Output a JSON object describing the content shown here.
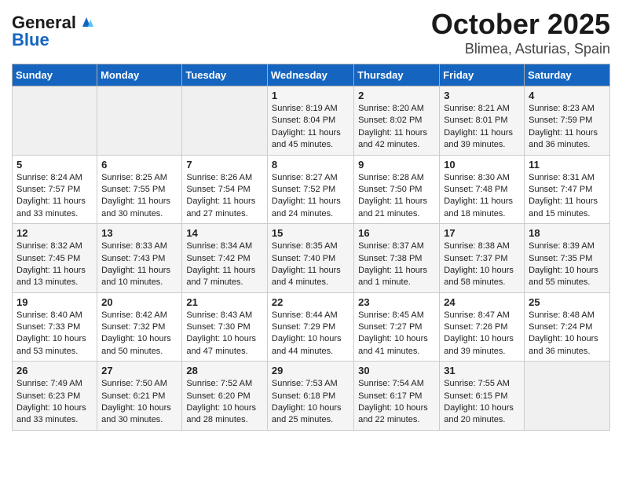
{
  "header": {
    "logo_line1": "General",
    "logo_line2": "Blue",
    "title": "October 2025",
    "subtitle": "Blimea, Asturias, Spain"
  },
  "weekdays": [
    "Sunday",
    "Monday",
    "Tuesday",
    "Wednesday",
    "Thursday",
    "Friday",
    "Saturday"
  ],
  "weeks": [
    [
      {
        "day": "",
        "info": ""
      },
      {
        "day": "",
        "info": ""
      },
      {
        "day": "",
        "info": ""
      },
      {
        "day": "1",
        "info": "Sunrise: 8:19 AM\nSunset: 8:04 PM\nDaylight: 11 hours and 45 minutes."
      },
      {
        "day": "2",
        "info": "Sunrise: 8:20 AM\nSunset: 8:02 PM\nDaylight: 11 hours and 42 minutes."
      },
      {
        "day": "3",
        "info": "Sunrise: 8:21 AM\nSunset: 8:01 PM\nDaylight: 11 hours and 39 minutes."
      },
      {
        "day": "4",
        "info": "Sunrise: 8:23 AM\nSunset: 7:59 PM\nDaylight: 11 hours and 36 minutes."
      }
    ],
    [
      {
        "day": "5",
        "info": "Sunrise: 8:24 AM\nSunset: 7:57 PM\nDaylight: 11 hours and 33 minutes."
      },
      {
        "day": "6",
        "info": "Sunrise: 8:25 AM\nSunset: 7:55 PM\nDaylight: 11 hours and 30 minutes."
      },
      {
        "day": "7",
        "info": "Sunrise: 8:26 AM\nSunset: 7:54 PM\nDaylight: 11 hours and 27 minutes."
      },
      {
        "day": "8",
        "info": "Sunrise: 8:27 AM\nSunset: 7:52 PM\nDaylight: 11 hours and 24 minutes."
      },
      {
        "day": "9",
        "info": "Sunrise: 8:28 AM\nSunset: 7:50 PM\nDaylight: 11 hours and 21 minutes."
      },
      {
        "day": "10",
        "info": "Sunrise: 8:30 AM\nSunset: 7:48 PM\nDaylight: 11 hours and 18 minutes."
      },
      {
        "day": "11",
        "info": "Sunrise: 8:31 AM\nSunset: 7:47 PM\nDaylight: 11 hours and 15 minutes."
      }
    ],
    [
      {
        "day": "12",
        "info": "Sunrise: 8:32 AM\nSunset: 7:45 PM\nDaylight: 11 hours and 13 minutes."
      },
      {
        "day": "13",
        "info": "Sunrise: 8:33 AM\nSunset: 7:43 PM\nDaylight: 11 hours and 10 minutes."
      },
      {
        "day": "14",
        "info": "Sunrise: 8:34 AM\nSunset: 7:42 PM\nDaylight: 11 hours and 7 minutes."
      },
      {
        "day": "15",
        "info": "Sunrise: 8:35 AM\nSunset: 7:40 PM\nDaylight: 11 hours and 4 minutes."
      },
      {
        "day": "16",
        "info": "Sunrise: 8:37 AM\nSunset: 7:38 PM\nDaylight: 11 hours and 1 minute."
      },
      {
        "day": "17",
        "info": "Sunrise: 8:38 AM\nSunset: 7:37 PM\nDaylight: 10 hours and 58 minutes."
      },
      {
        "day": "18",
        "info": "Sunrise: 8:39 AM\nSunset: 7:35 PM\nDaylight: 10 hours and 55 minutes."
      }
    ],
    [
      {
        "day": "19",
        "info": "Sunrise: 8:40 AM\nSunset: 7:33 PM\nDaylight: 10 hours and 53 minutes."
      },
      {
        "day": "20",
        "info": "Sunrise: 8:42 AM\nSunset: 7:32 PM\nDaylight: 10 hours and 50 minutes."
      },
      {
        "day": "21",
        "info": "Sunrise: 8:43 AM\nSunset: 7:30 PM\nDaylight: 10 hours and 47 minutes."
      },
      {
        "day": "22",
        "info": "Sunrise: 8:44 AM\nSunset: 7:29 PM\nDaylight: 10 hours and 44 minutes."
      },
      {
        "day": "23",
        "info": "Sunrise: 8:45 AM\nSunset: 7:27 PM\nDaylight: 10 hours and 41 minutes."
      },
      {
        "day": "24",
        "info": "Sunrise: 8:47 AM\nSunset: 7:26 PM\nDaylight: 10 hours and 39 minutes."
      },
      {
        "day": "25",
        "info": "Sunrise: 8:48 AM\nSunset: 7:24 PM\nDaylight: 10 hours and 36 minutes."
      }
    ],
    [
      {
        "day": "26",
        "info": "Sunrise: 7:49 AM\nSunset: 6:23 PM\nDaylight: 10 hours and 33 minutes."
      },
      {
        "day": "27",
        "info": "Sunrise: 7:50 AM\nSunset: 6:21 PM\nDaylight: 10 hours and 30 minutes."
      },
      {
        "day": "28",
        "info": "Sunrise: 7:52 AM\nSunset: 6:20 PM\nDaylight: 10 hours and 28 minutes."
      },
      {
        "day": "29",
        "info": "Sunrise: 7:53 AM\nSunset: 6:18 PM\nDaylight: 10 hours and 25 minutes."
      },
      {
        "day": "30",
        "info": "Sunrise: 7:54 AM\nSunset: 6:17 PM\nDaylight: 10 hours and 22 minutes."
      },
      {
        "day": "31",
        "info": "Sunrise: 7:55 AM\nSunset: 6:15 PM\nDaylight: 10 hours and 20 minutes."
      },
      {
        "day": "",
        "info": ""
      }
    ]
  ]
}
